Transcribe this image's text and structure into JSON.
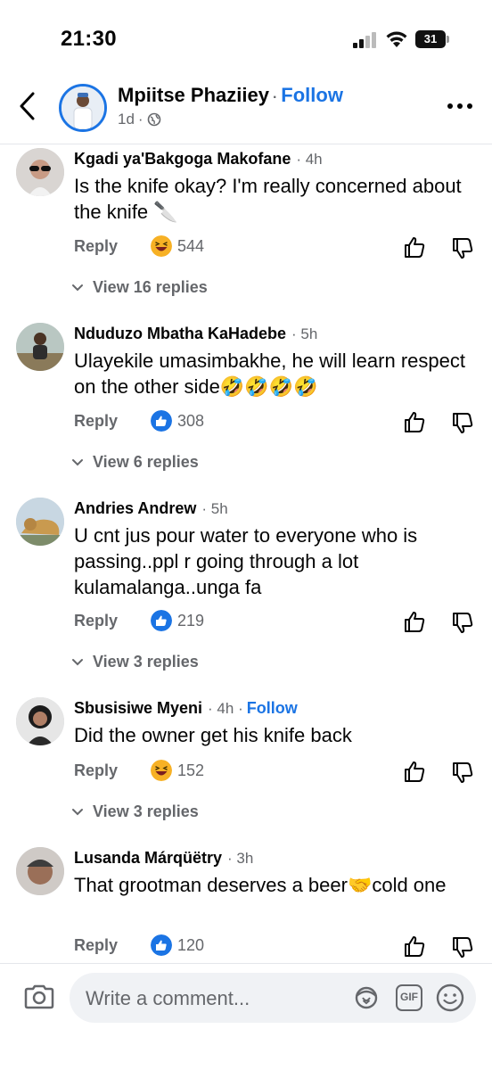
{
  "status_bar": {
    "time": "21:30",
    "battery": "31"
  },
  "header": {
    "name": "Mpiitse Phaziiey",
    "separator": "·",
    "follow": "Follow",
    "meta": "1d",
    "meta_separator": "·"
  },
  "comments": [
    {
      "author": "Kgadi ya'Bakgoga Makofane",
      "time": "· 4h",
      "text": "Is the knife okay? I'm really concerned about the knife 🔪",
      "reply": "Reply",
      "reaction": "laugh",
      "count": "544",
      "view_replies": "View 16 replies"
    },
    {
      "author": "Nduduzo Mbatha KaHadebe",
      "time": "· 5h",
      "text": "Ulayekile umasimbakhe, he will learn respect on the other side🤣🤣🤣🤣",
      "reply": "Reply",
      "reaction": "like",
      "count": "308",
      "view_replies": "View 6 replies"
    },
    {
      "author": "Andries Andrew",
      "time": "· 5h",
      "text": "U cnt jus pour water to everyone who is passing..ppl r going through a lot kulamalanga..unga fa",
      "reply": "Reply",
      "reaction": "like",
      "count": "219",
      "view_replies": "View 3 replies"
    },
    {
      "author": "Sbusisiwe Myeni",
      "time": "· 4h ·",
      "follow": "Follow",
      "text": "Did the owner get his knife back",
      "reply": "Reply",
      "reaction": "laugh",
      "count": "152",
      "view_replies": "View 3 replies"
    },
    {
      "author": "Lusanda Márqüëtry",
      "time": "· 3h",
      "text": "That grootman deserves a beer🤝cold one",
      "reply": "Reply",
      "reaction": "like",
      "count": "120"
    }
  ],
  "composer": {
    "placeholder": "Write a comment...",
    "gif_label": "GIF"
  },
  "colors": {
    "accent": "#1b74e4",
    "secondary_text": "#65676b",
    "laugh": "#f7b125"
  }
}
